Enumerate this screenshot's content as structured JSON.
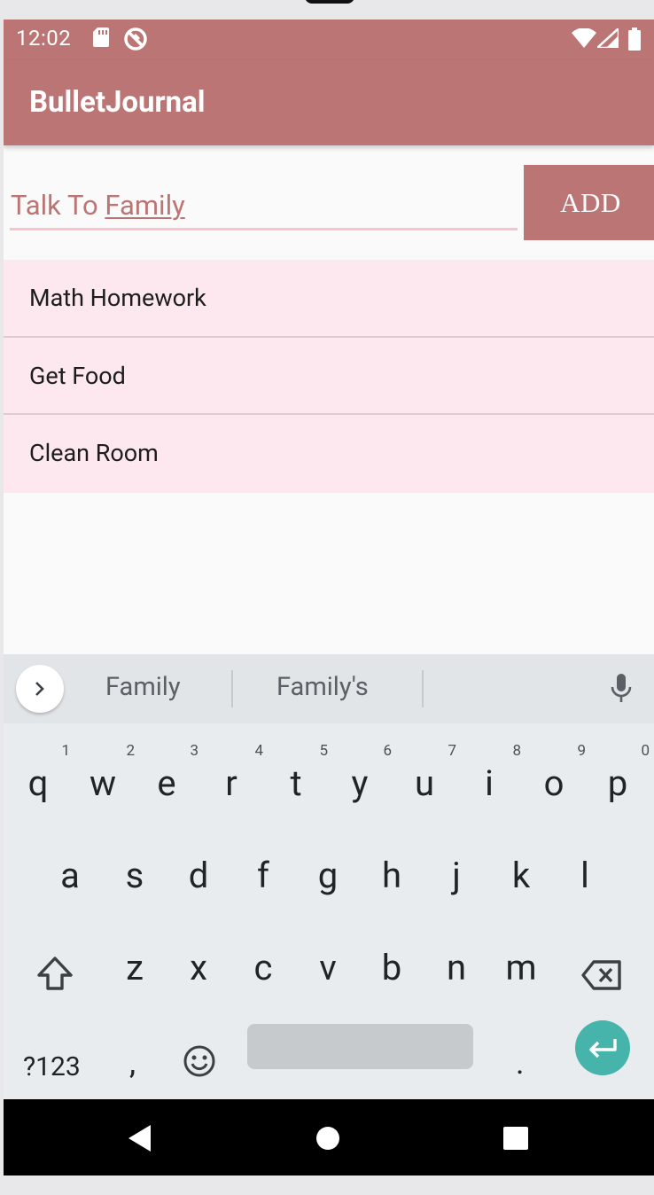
{
  "status_bar": {
    "time": "12:02",
    "icons": [
      "sd-card-icon",
      "sync-disabled-icon",
      "wifi-icon",
      "signal-icon",
      "battery-icon"
    ],
    "background": "#bb7575"
  },
  "app_bar": {
    "title": "BulletJournal",
    "background": "#bb7575"
  },
  "task_input": {
    "value_prefix": "Talk To ",
    "value_composing": "Family",
    "text_color": "#bb7575",
    "underline_color": "#f6c3cf"
  },
  "add_button": {
    "label": "ADD"
  },
  "tasks": [
    {
      "label": "Math Homework"
    },
    {
      "label": "Get Food"
    },
    {
      "label": "Clean Room"
    }
  ],
  "keyboard": {
    "suggestions": [
      "Family",
      "Family's"
    ],
    "row1": [
      {
        "key": "q",
        "hint": "1"
      },
      {
        "key": "w",
        "hint": "2"
      },
      {
        "key": "e",
        "hint": "3"
      },
      {
        "key": "r",
        "hint": "4"
      },
      {
        "key": "t",
        "hint": "5"
      },
      {
        "key": "y",
        "hint": "6"
      },
      {
        "key": "u",
        "hint": "7"
      },
      {
        "key": "i",
        "hint": "8"
      },
      {
        "key": "o",
        "hint": "9"
      },
      {
        "key": "p",
        "hint": "0"
      }
    ],
    "row2": [
      "a",
      "s",
      "d",
      "f",
      "g",
      "h",
      "j",
      "k",
      "l"
    ],
    "row3": [
      "z",
      "x",
      "c",
      "v",
      "b",
      "n",
      "m"
    ],
    "symbols_label": "?123",
    "comma": ",",
    "period": ".",
    "enter_color": "#46b4ab"
  }
}
